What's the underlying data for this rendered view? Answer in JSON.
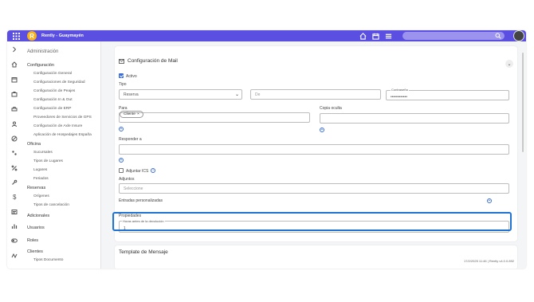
{
  "header": {
    "app_title": "Rently - Guaymayén",
    "logo_letter": "R",
    "accent": "#5a4fe0",
    "icons": [
      "apps-grid-icon",
      "home-icon",
      "calendar-icon",
      "menu-icon",
      "search-icon"
    ]
  },
  "sidebar": {
    "section_admin": "Administración",
    "configuracion": "Configuración",
    "config_items": [
      "Configuración General",
      "Configuraciones de Seguridad",
      "Configuración de Peajes",
      "Configuración In & Out",
      "Configuración de ERP",
      "Proveedores de Servicios de GPS",
      "Configuración de Axle Insure",
      "Aplicación de Hospedajes España"
    ],
    "oficina": "Oficina",
    "oficina_items": [
      "Sucursales",
      "Tipos de Lugares",
      "Lugares",
      "Feriados"
    ],
    "reservas": "Reservas",
    "reservas_items": [
      "Orígenes",
      "Tipos de cancelación"
    ],
    "adicionales": "Adicionales",
    "usuarios": "Usuarios",
    "roles": "Roles",
    "clientes": "Clientes",
    "clientes_items": [
      "Tipos Documento"
    ]
  },
  "mail_config": {
    "title": "Configuración de Mail",
    "activo_label": "Activo",
    "activo_checked": true,
    "tipo_label": "Tipo",
    "tipo_value": "Reserva",
    "de_placeholder": "De",
    "password_label": "Contraseña",
    "password_value": "••••••••••••",
    "para_label": "Para",
    "para_chip": "Cliente",
    "copia_oculta_label": "Copia oculta",
    "responder_label": "Responder a",
    "adjuntar_ics_label": "Adjuntar ICS",
    "adjuntos_label": "Adjuntos",
    "adjuntos_placeholder": "Seleccione",
    "entradas_label": "Entradas personalizadas",
    "propiedades_label": "Propiedades",
    "horas_label": "Horas antes de la devolución",
    "horas_value": "1"
  },
  "template": {
    "title": "Template de Mensaje"
  },
  "footer": {
    "text": "17/2/2025 11:46 | Rently v4.0.0.892"
  }
}
